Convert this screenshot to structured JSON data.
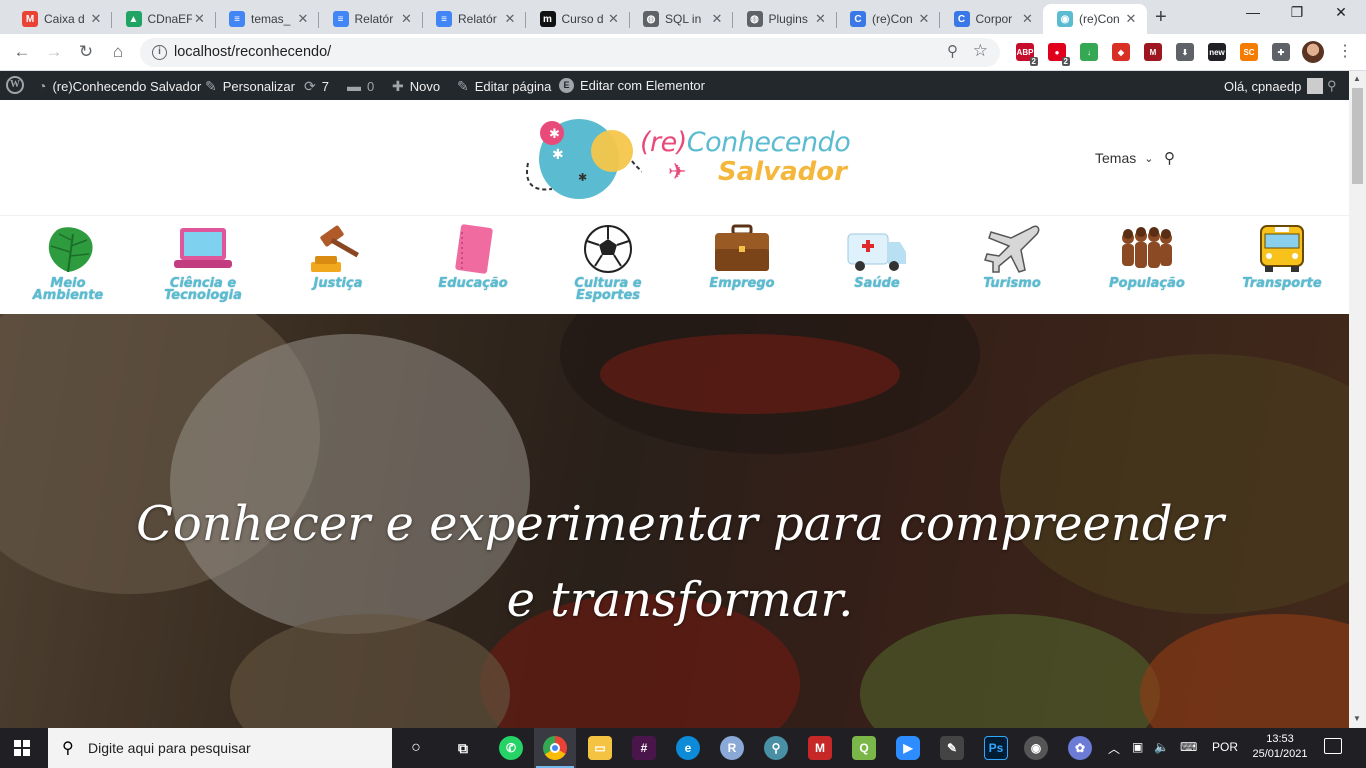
{
  "browser": {
    "tabs": [
      {
        "title": "Caixa d",
        "fav_color": "#ea4335",
        "fav_glyph": "M"
      },
      {
        "title": "CDnaEF",
        "fav_color": "#1fa463",
        "fav_glyph": "▲"
      },
      {
        "title": "temas_",
        "fav_color": "#4285f4",
        "fav_glyph": "≡"
      },
      {
        "title": "Relatór",
        "fav_color": "#4285f4",
        "fav_glyph": "≡"
      },
      {
        "title": "Relatór",
        "fav_color": "#4285f4",
        "fav_glyph": "≡"
      },
      {
        "title": "Curso d",
        "fav_color": "#111111",
        "fav_glyph": "m"
      },
      {
        "title": "SQL in",
        "fav_color": "#5f6368",
        "fav_glyph": "◍"
      },
      {
        "title": "Plugins",
        "fav_color": "#5f6368",
        "fav_glyph": "◍"
      },
      {
        "title": "(re)Con",
        "fav_color": "#3b78e7",
        "fav_glyph": "C"
      },
      {
        "title": "Corpor",
        "fav_color": "#3b78e7",
        "fav_glyph": "C"
      },
      {
        "title": "(re)Con",
        "fav_color": "#5bbbd0",
        "fav_glyph": "◉",
        "active": true
      }
    ],
    "url": "localhost/reconhecendo/",
    "extensions": [
      {
        "name": "abp-icon",
        "color": "#c70d2c",
        "label": "ABP",
        "badge": "2"
      },
      {
        "name": "ublock-icon",
        "color": "#e0001b",
        "label": "●",
        "badge": "2"
      },
      {
        "name": "download-manager-icon",
        "color": "#34a853",
        "label": "↓",
        "badge": ""
      },
      {
        "name": "shield-icon",
        "color": "#d93025",
        "label": "◆",
        "badge": ""
      },
      {
        "name": "mendeley-icon",
        "color": "#9d1620",
        "label": "M",
        "badge": ""
      },
      {
        "name": "save-icon",
        "color": "#5f6368",
        "label": "⬇",
        "badge": ""
      },
      {
        "name": "news-icon",
        "color": "#202124",
        "label": "new",
        "badge": ""
      },
      {
        "name": "sc-icon",
        "color": "#f57c00",
        "label": "SC",
        "badge": ""
      },
      {
        "name": "puzzle-icon",
        "color": "#5f6368",
        "label": "✚",
        "badge": ""
      }
    ]
  },
  "adminbar": {
    "site_name": "(re)Conhecendo Salvador",
    "customize": "Personalizar",
    "updates": "7",
    "comments": "0",
    "new": "Novo",
    "edit_page": "Editar página",
    "edit_elementor": "Editar com Elementor",
    "greeting": "Olá, cpnaedp"
  },
  "site": {
    "logo_re": "(re)",
    "logo_conhecendo": "Conhecendo",
    "logo_salvador": "Salvador",
    "menu_temas": "Temas",
    "themes": [
      {
        "label": "Meio Ambiente",
        "icon": "leaf-icon"
      },
      {
        "label": "Ciência e Tecnologia",
        "icon": "laptop-icon"
      },
      {
        "label": "Justiça",
        "icon": "gavel-icon"
      },
      {
        "label": "Educação",
        "icon": "notebook-icon"
      },
      {
        "label": "Cultura e Esportes",
        "icon": "soccer-ball-icon"
      },
      {
        "label": "Emprego",
        "icon": "briefcase-icon"
      },
      {
        "label": "Saúde",
        "icon": "ambulance-icon"
      },
      {
        "label": "Turismo",
        "icon": "airplane-icon"
      },
      {
        "label": "População",
        "icon": "people-icon"
      },
      {
        "label": "Transporte",
        "icon": "bus-icon"
      }
    ],
    "hero_text": "Conhecer e experimentar para compreender e transformar."
  },
  "taskbar": {
    "search_placeholder": "Digite aqui para pesquisar",
    "language": "POR",
    "time": "13:53",
    "date": "25/01/2021"
  }
}
